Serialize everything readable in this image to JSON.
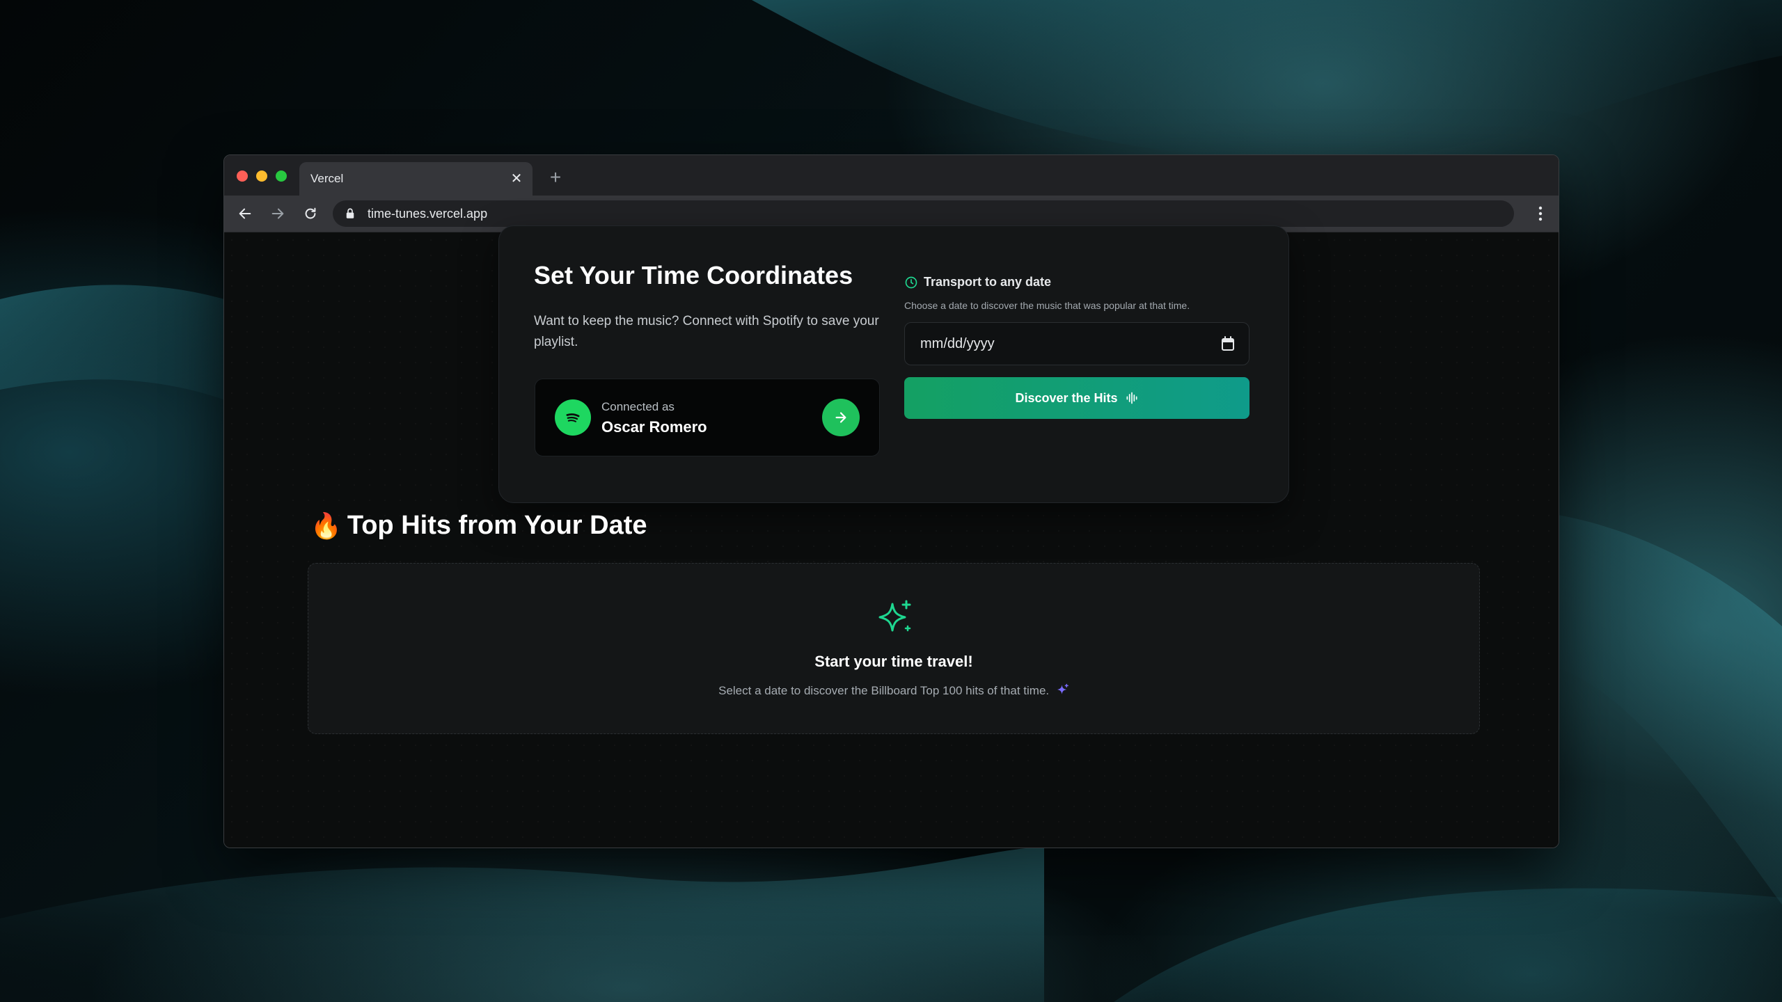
{
  "browser": {
    "tab_title": "Vercel",
    "url": "time-tunes.vercel.app"
  },
  "coordinates": {
    "title": "Set Your Time Coordinates",
    "description": "Want to keep the music? Connect with Spotify to save your playlist.",
    "spotify": {
      "connected_label": "Connected as",
      "user_name": "Oscar Romero"
    },
    "transport": {
      "title": "Transport to any date",
      "description": "Choose a date to discover the music that was popular at that time.",
      "date_placeholder": "mm/dd/yyyy"
    },
    "discover_label": "Discover the Hits"
  },
  "hits": {
    "emoji": "🔥",
    "title": "Top Hits from Your Date",
    "empty_title": "Start your time travel!",
    "empty_description": "Select a date to discover the Billboard Top 100 hits of that time."
  },
  "colors": {
    "accent_green": "#1ed760",
    "button_gradient_start": "#14a063",
    "button_gradient_end": "#0f9b8a",
    "sparkle": "#1ed790",
    "mini_sparkle": "#7b6cff"
  },
  "icons": {
    "tab_close": "close-icon",
    "new_tab": "plus-icon",
    "back": "arrow-left-icon",
    "forward": "arrow-right-icon",
    "reload": "reload-icon",
    "lock": "lock-icon",
    "menu": "kebab-menu-icon",
    "spotify": "spotify-icon",
    "go": "arrow-right-icon",
    "transport": "clock-icon",
    "calendar": "calendar-icon",
    "discover": "audio-lines-icon",
    "hits_heading": "fire-emoji",
    "empty_state": "sparkles-icon"
  }
}
